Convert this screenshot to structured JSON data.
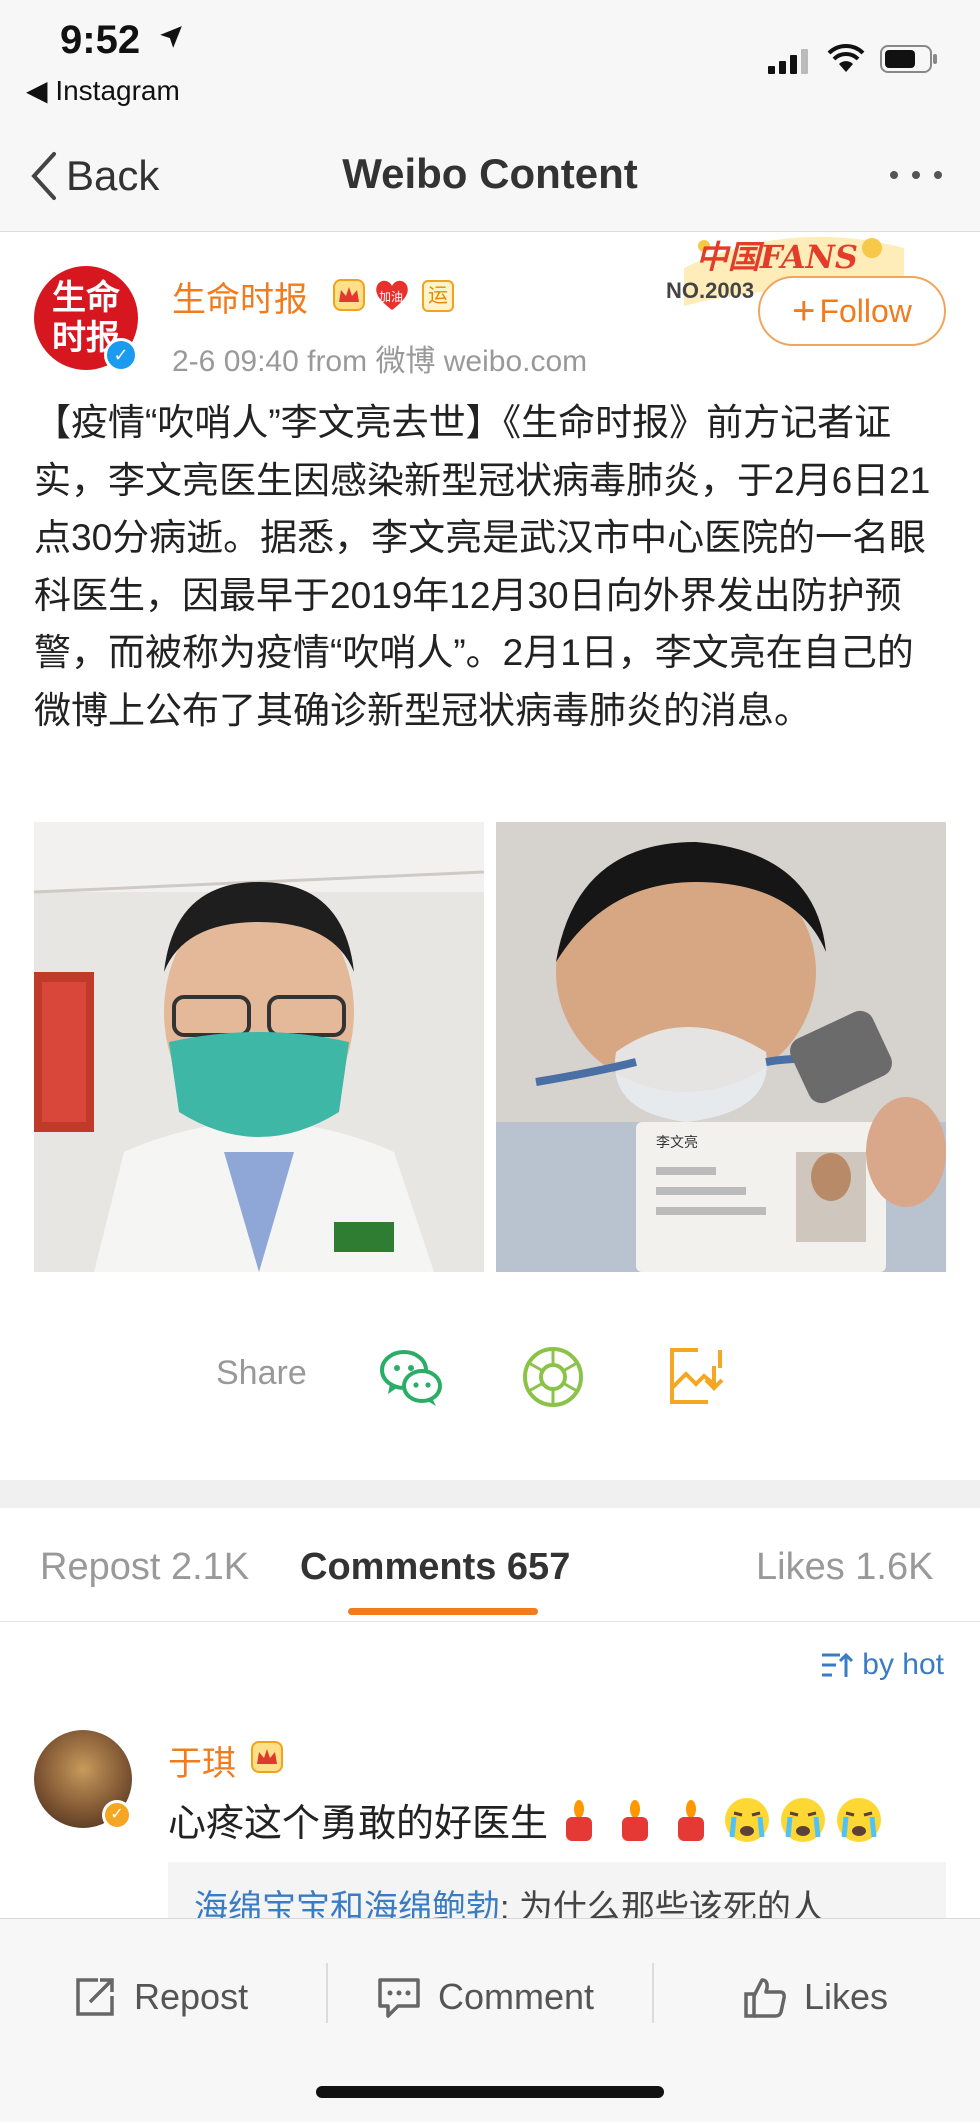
{
  "status_bar": {
    "time": "9:52",
    "back_app": "◀ Instagram"
  },
  "nav": {
    "back_label": "Back",
    "title": "Weibo Content"
  },
  "post": {
    "author": "生命时报",
    "avatar_text_line1": "生命",
    "avatar_text_line2": "时报",
    "badge_heart_text": "加油",
    "badge_yun_text": "运",
    "meta": "2-6 09:40  from 微博 weibo.com",
    "fans_badge_title": "中国FANS",
    "fans_badge_no": "NO.2003",
    "follow_plus": "+",
    "follow_label": "Follow",
    "text": "【疫情“吹哨人”李文亮去世】《生命时报》前方记者证实，李文亮医生因感染新型冠状病毒肺炎，于2月6日21点30分病逝。据悉，李文亮是武汉市中心医院的一名眼科医生，因最早于2019年12月30日向外界发出防护预警，而被称为疫情“吹哨人”。2月1日，李文亮在自己的微博上公布了其确诊新型冠状病毒肺炎的消息。",
    "photo_id_card_name": "李文亮"
  },
  "share": {
    "label": "Share",
    "icons": [
      "wechat-icon",
      "moments-icon",
      "save-image-icon"
    ]
  },
  "tabs": {
    "repost": "Repost 2.1K",
    "comments": "Comments 657",
    "likes": "Likes 1.6K"
  },
  "sort": {
    "label": "by hot"
  },
  "comment": {
    "user": "于琪",
    "text": "心疼这个勇敢的好医生",
    "emojis": [
      "candle",
      "candle",
      "candle",
      "crying-face",
      "crying-face",
      "crying-face"
    ],
    "reply_user": "海绵宝宝和海绵鲍勃",
    "reply_text": ": 为什么那些该死的人"
  },
  "bottom_bar": {
    "repost": "Repost",
    "comment": "Comment",
    "likes": "Likes"
  },
  "colors": {
    "accent_orange": "#f07c1e",
    "link_blue": "#3a7cc4",
    "brand_red": "#d7171f",
    "wechat_green": "#2aae67",
    "moments_green": "#8bc34a",
    "save_orange": "#f5a623"
  }
}
